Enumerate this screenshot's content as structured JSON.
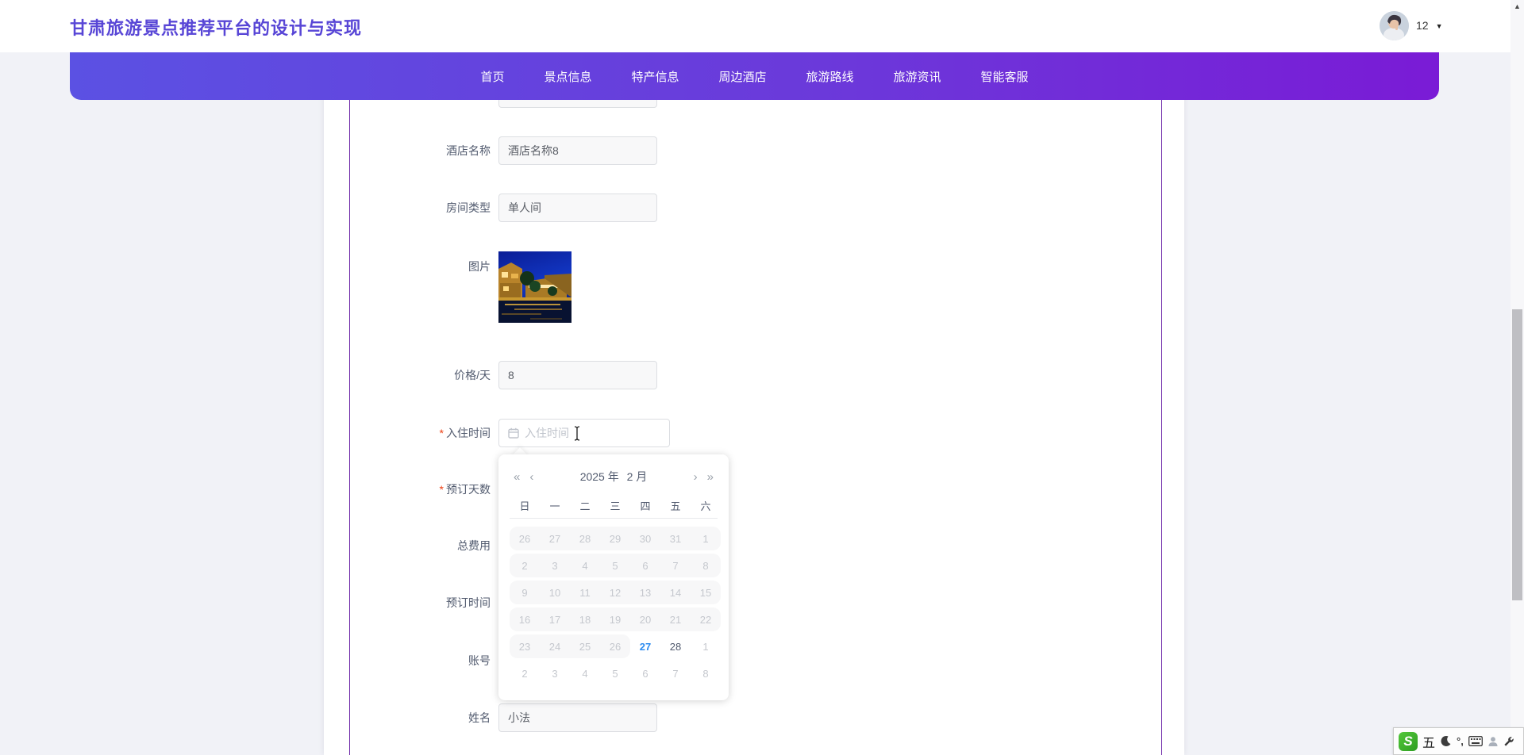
{
  "colors": {
    "accent_purple": "#5846d6",
    "nav_gradient_left": "#5b51e3",
    "nav_gradient_right": "#7a1bd6",
    "inner_border": "#6d28a8",
    "selected_date_blue": "#2d8cf0",
    "required_red": "#ed4014"
  },
  "header": {
    "title": "甘肃旅游景点推荐平台的设计与实现",
    "user_label": "12",
    "user_caret": "▼"
  },
  "nav": {
    "items": [
      {
        "label": "首页"
      },
      {
        "label": "景点信息"
      },
      {
        "label": "特产信息"
      },
      {
        "label": "周边酒店"
      },
      {
        "label": "旅游路线"
      },
      {
        "label": "旅游资讯"
      },
      {
        "label": "智能客服"
      }
    ]
  },
  "form": {
    "fields": {
      "hotel_name": {
        "label": "酒店名称",
        "value": "酒店名称8"
      },
      "room_type": {
        "label": "房间类型",
        "value": "单人间"
      },
      "image": {
        "label": "图片"
      },
      "price": {
        "label": "价格/天",
        "value": "8"
      },
      "checkin": {
        "label": "入住时间",
        "required_mark": "*",
        "placeholder": "入住时间"
      },
      "days": {
        "label": "预订天数",
        "required_mark": "*"
      },
      "cost": {
        "label": "总费用"
      },
      "booking_time": {
        "label": "预订时间"
      },
      "account": {
        "label": "账号"
      },
      "name": {
        "label": "姓名",
        "value": "小法"
      }
    }
  },
  "datepicker": {
    "prev_year": "«",
    "prev_month": "‹",
    "next_month": "›",
    "next_year": "»",
    "year_label": "2025 年",
    "month_label": "2 月",
    "weekdays": [
      {
        "label": "日"
      },
      {
        "label": "一"
      },
      {
        "label": "二"
      },
      {
        "label": "三"
      },
      {
        "label": "四"
      },
      {
        "label": "五"
      },
      {
        "label": "六"
      }
    ],
    "cells": [
      {
        "d": "26",
        "state": "dis-start",
        "interactable": "false"
      },
      {
        "d": "27",
        "state": "dis",
        "interactable": "false"
      },
      {
        "d": "28",
        "state": "dis",
        "interactable": "false"
      },
      {
        "d": "29",
        "state": "dis",
        "interactable": "false"
      },
      {
        "d": "30",
        "state": "dis",
        "interactable": "false"
      },
      {
        "d": "31",
        "state": "dis",
        "interactable": "false"
      },
      {
        "d": "1",
        "state": "dis-end",
        "interactable": "false"
      },
      {
        "d": "2",
        "state": "dis-start",
        "interactable": "false"
      },
      {
        "d": "3",
        "state": "dis",
        "interactable": "false"
      },
      {
        "d": "4",
        "state": "dis",
        "interactable": "false"
      },
      {
        "d": "5",
        "state": "dis",
        "interactable": "false"
      },
      {
        "d": "6",
        "state": "dis",
        "interactable": "false"
      },
      {
        "d": "7",
        "state": "dis",
        "interactable": "false"
      },
      {
        "d": "8",
        "state": "dis-end",
        "interactable": "false"
      },
      {
        "d": "9",
        "state": "dis-start",
        "interactable": "false"
      },
      {
        "d": "10",
        "state": "dis",
        "interactable": "false"
      },
      {
        "d": "11",
        "state": "dis",
        "interactable": "false"
      },
      {
        "d": "12",
        "state": "dis",
        "interactable": "false"
      },
      {
        "d": "13",
        "state": "dis",
        "interactable": "false"
      },
      {
        "d": "14",
        "state": "dis",
        "interactable": "false"
      },
      {
        "d": "15",
        "state": "dis-end",
        "interactable": "false"
      },
      {
        "d": "16",
        "state": "dis-start",
        "interactable": "false"
      },
      {
        "d": "17",
        "state": "dis",
        "interactable": "false"
      },
      {
        "d": "18",
        "state": "dis",
        "interactable": "false"
      },
      {
        "d": "19",
        "state": "dis",
        "interactable": "false"
      },
      {
        "d": "20",
        "state": "dis",
        "interactable": "false"
      },
      {
        "d": "21",
        "state": "dis",
        "interactable": "false"
      },
      {
        "d": "22",
        "state": "dis-end",
        "interactable": "false"
      },
      {
        "d": "23",
        "state": "dis-start",
        "interactable": "false"
      },
      {
        "d": "24",
        "state": "dis",
        "interactable": "false"
      },
      {
        "d": "25",
        "state": "dis",
        "interactable": "false"
      },
      {
        "d": "26",
        "state": "dis-end",
        "interactable": "false"
      },
      {
        "d": "27",
        "state": "today",
        "interactable": "true"
      },
      {
        "d": "28",
        "state": "normal",
        "interactable": "true"
      },
      {
        "d": "1",
        "state": "other",
        "interactable": "true"
      },
      {
        "d": "2",
        "state": "other",
        "interactable": "true"
      },
      {
        "d": "3",
        "state": "other",
        "interactable": "true"
      },
      {
        "d": "4",
        "state": "other",
        "interactable": "true"
      },
      {
        "d": "5",
        "state": "other",
        "interactable": "true"
      },
      {
        "d": "6",
        "state": "other",
        "interactable": "true"
      },
      {
        "d": "7",
        "state": "other",
        "interactable": "true"
      },
      {
        "d": "8",
        "state": "other",
        "interactable": "true"
      }
    ]
  },
  "scrollbar": {
    "up_arrow": "▲"
  },
  "ime": {
    "logo": "S",
    "wubi_label": "五",
    "punct_label": "°,"
  }
}
